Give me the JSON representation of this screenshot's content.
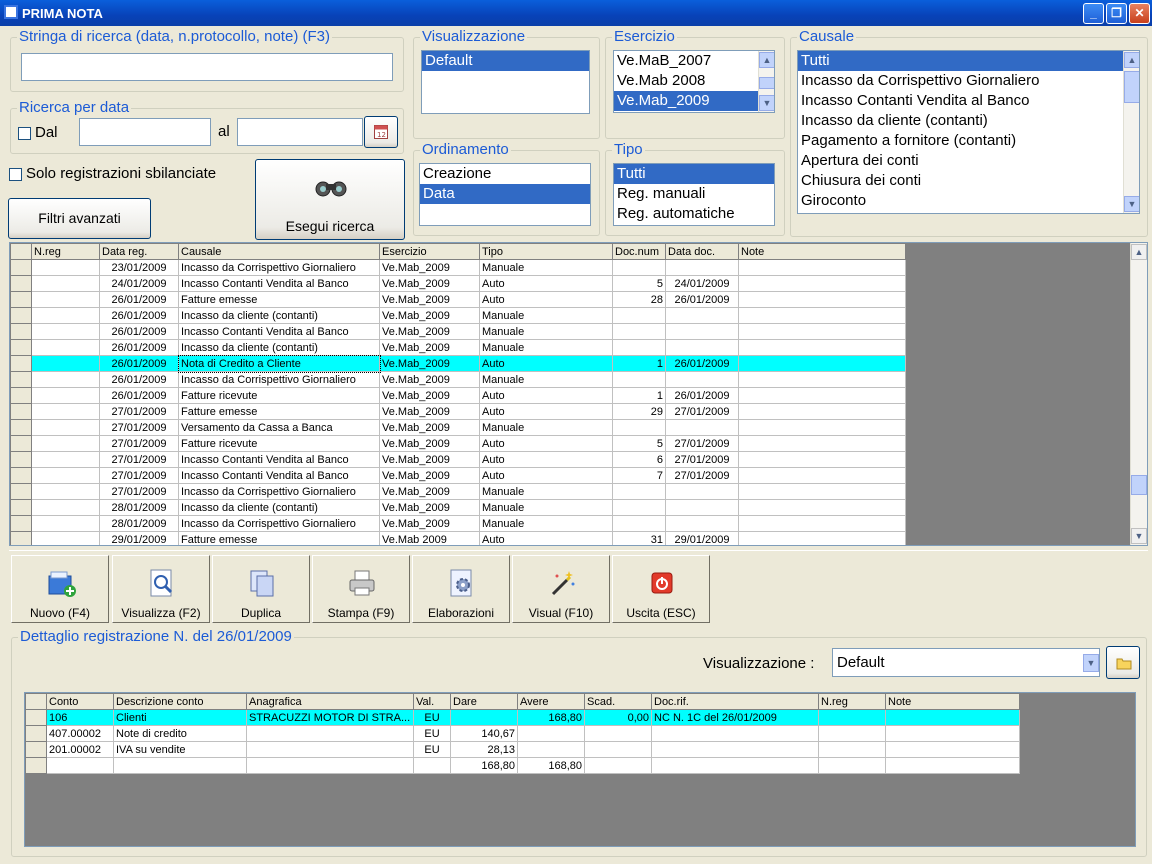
{
  "window": {
    "title": "PRIMA NOTA",
    "minimize": "_",
    "maximize": "❐",
    "close": "✕"
  },
  "search": {
    "label": "Stringa di ricerca (data, n.protocollo, note) (F3)",
    "value": ""
  },
  "date_search": {
    "label": "Ricerca per data",
    "from_label": "Dal",
    "to_label": "al",
    "from_value": "",
    "to_value": ""
  },
  "only_unbalanced": {
    "label": "Solo registrazioni sbilanciate"
  },
  "advanced_filters": {
    "label": "Filtri avanzati"
  },
  "execute_search": {
    "label": "Esegui ricerca"
  },
  "visualizzazione": {
    "label": "Visualizzazione",
    "items": [
      "Default"
    ],
    "selected": 0
  },
  "ordinamento": {
    "label": "Ordinamento",
    "items": [
      "Creazione",
      "Data"
    ],
    "selected": 1
  },
  "esercizio": {
    "label": "Esercizio",
    "items": [
      "Ve.MaB_2007",
      "Ve.Mab 2008",
      "Ve.Mab_2009"
    ],
    "selected": 2
  },
  "tipo": {
    "label": "Tipo",
    "items": [
      "Tutti",
      "Reg. manuali",
      "Reg. automatiche"
    ],
    "selected": 0
  },
  "causale": {
    "label": "Causale",
    "items": [
      "Tutti",
      "Incasso da Corrispettivo Giornaliero",
      "Incasso Contanti Vendita al Banco",
      "Incasso da cliente (contanti)",
      "Pagamento a fornitore (contanti)",
      "Apertura dei conti",
      "Chiusura dei conti",
      "Giroconto"
    ],
    "selected": 0
  },
  "main_grid": {
    "columns": [
      "N.reg",
      "Data reg.",
      "Causale",
      "Esercizio",
      "Tipo",
      "Doc.num",
      "Data doc.",
      "Note"
    ],
    "highlight_index": 6,
    "rows": [
      [
        "",
        "23/01/2009",
        "Incasso da Corrispettivo Giornaliero",
        "Ve.Mab_2009",
        "Manuale",
        "",
        "",
        ""
      ],
      [
        "",
        "24/01/2009",
        "Incasso Contanti Vendita al Banco",
        "Ve.Mab_2009",
        "Auto",
        "5",
        "24/01/2009",
        ""
      ],
      [
        "",
        "26/01/2009",
        "Fatture emesse",
        "Ve.Mab_2009",
        "Auto",
        "28",
        "26/01/2009",
        ""
      ],
      [
        "",
        "26/01/2009",
        "Incasso da cliente (contanti)",
        "Ve.Mab_2009",
        "Manuale",
        "",
        "",
        ""
      ],
      [
        "",
        "26/01/2009",
        "Incasso Contanti Vendita al Banco",
        "Ve.Mab_2009",
        "Manuale",
        "",
        "",
        ""
      ],
      [
        "",
        "26/01/2009",
        "Incasso da cliente (contanti)",
        "Ve.Mab_2009",
        "Manuale",
        "",
        "",
        ""
      ],
      [
        "",
        "26/01/2009",
        "Nota di Credito a Cliente",
        "Ve.Mab_2009",
        "Auto",
        "1",
        "26/01/2009",
        ""
      ],
      [
        "",
        "26/01/2009",
        "Incasso da Corrispettivo Giornaliero",
        "Ve.Mab_2009",
        "Manuale",
        "",
        "",
        ""
      ],
      [
        "",
        "26/01/2009",
        "Fatture ricevute",
        "Ve.Mab_2009",
        "Auto",
        "1",
        "26/01/2009",
        ""
      ],
      [
        "",
        "27/01/2009",
        "Fatture emesse",
        "Ve.Mab_2009",
        "Auto",
        "29",
        "27/01/2009",
        ""
      ],
      [
        "",
        "27/01/2009",
        "Versamento da Cassa a Banca",
        "Ve.Mab_2009",
        "Manuale",
        "",
        "",
        ""
      ],
      [
        "",
        "27/01/2009",
        "Fatture ricevute",
        "Ve.Mab_2009",
        "Auto",
        "5",
        "27/01/2009",
        ""
      ],
      [
        "",
        "27/01/2009",
        "Incasso Contanti Vendita al Banco",
        "Ve.Mab_2009",
        "Auto",
        "6",
        "27/01/2009",
        ""
      ],
      [
        "",
        "27/01/2009",
        "Incasso Contanti Vendita al Banco",
        "Ve.Mab_2009",
        "Auto",
        "7",
        "27/01/2009",
        ""
      ],
      [
        "",
        "27/01/2009",
        "Incasso da Corrispettivo Giornaliero",
        "Ve.Mab_2009",
        "Manuale",
        "",
        "",
        ""
      ],
      [
        "",
        "28/01/2009",
        "Incasso da cliente (contanti)",
        "Ve.Mab_2009",
        "Manuale",
        "",
        "",
        ""
      ],
      [
        "",
        "28/01/2009",
        "Incasso da Corrispettivo Giornaliero",
        "Ve.Mab_2009",
        "Manuale",
        "",
        "",
        ""
      ],
      [
        "",
        "29/01/2009",
        "Fatture emesse",
        "Ve.Mab 2009",
        "Auto",
        "31",
        "29/01/2009",
        ""
      ]
    ]
  },
  "toolbar": {
    "buttons": [
      {
        "label": "Nuovo (F4)",
        "icon": "new-folder-icon"
      },
      {
        "label": "Visualizza (F2)",
        "icon": "view-magnifier-icon"
      },
      {
        "label": "Duplica",
        "icon": "duplicate-icon"
      },
      {
        "label": "Stampa (F9)",
        "icon": "printer-icon"
      },
      {
        "label": "Elaborazioni",
        "icon": "process-gear-icon"
      },
      {
        "label": "Visual (F10)",
        "icon": "magic-wand-icon"
      },
      {
        "label": "Uscita (ESC)",
        "icon": "power-exit-icon"
      }
    ]
  },
  "detail": {
    "title": "Dettaglio registrazione N.  del 26/01/2009",
    "view_label": "Visualizzazione :",
    "view_value": "Default",
    "columns": [
      "Conto",
      "Descrizione conto",
      "Anagrafica",
      "Val.",
      "Dare",
      "Avere",
      "Scad.",
      "Doc.rif.",
      "N.reg",
      "Note"
    ],
    "rows": [
      [
        "106",
        "Clienti",
        "STRACUZZI MOTOR DI STRA...",
        "EU",
        "",
        "168,80",
        "0,00",
        "NC N. 1C del 26/01/2009",
        "",
        ""
      ],
      [
        "407.00002",
        "Note di credito",
        "",
        "EU",
        "140,67",
        "",
        "",
        "",
        "",
        ""
      ],
      [
        "201.00002",
        "IVA su vendite",
        "",
        "EU",
        "28,13",
        "",
        "",
        "",
        "",
        ""
      ],
      [
        "",
        "",
        "",
        "",
        "168,80",
        "168,80",
        "",
        "",
        "",
        ""
      ]
    ]
  }
}
